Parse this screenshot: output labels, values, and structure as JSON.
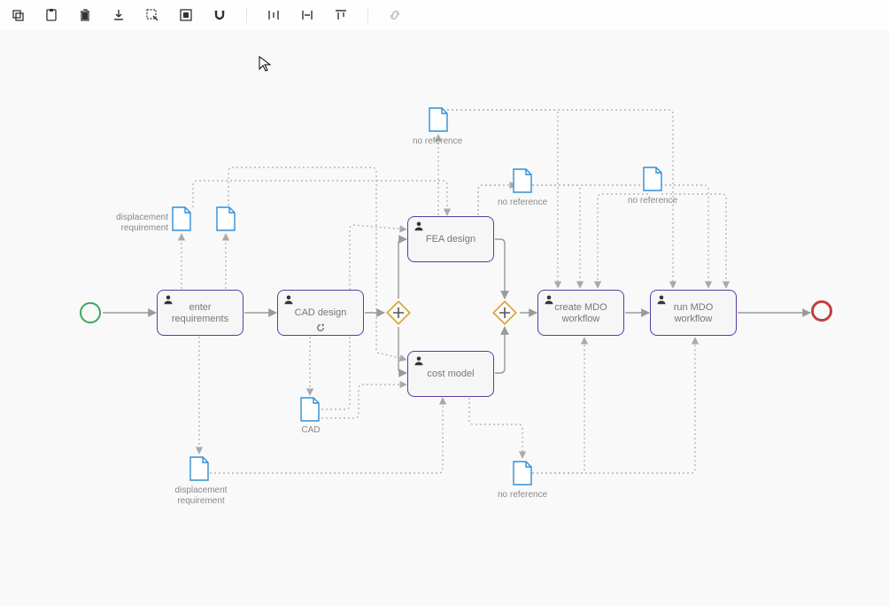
{
  "toolbar": {
    "buttons": [
      "copy",
      "paste",
      "delete",
      "download",
      "lasso",
      "group",
      "magnet",
      "distribute-h",
      "distribute-v",
      "align-top",
      "link"
    ]
  },
  "tasks": {
    "enter_requirements": "enter requirements",
    "cad_design": "CAD design",
    "fea_design": "FEA design",
    "cost_model": "cost model",
    "create_mdo": "create MDO workflow",
    "run_mdo": "run MDO workflow"
  },
  "docs": {
    "disp_top": "displacement\nrequirement",
    "cad": "CAD",
    "disp_bottom": "displacement\nrequirement",
    "noref_top": "no reference",
    "noref_mid": "no reference",
    "noref_right": "no reference",
    "noref_bottom": "no reference"
  }
}
